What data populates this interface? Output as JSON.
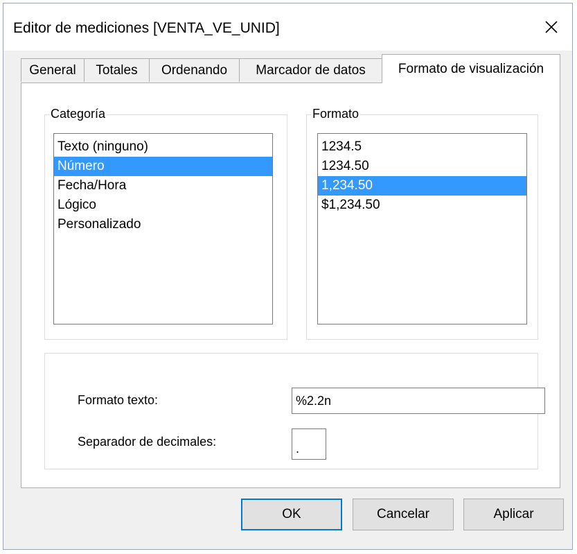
{
  "window": {
    "title": "Editor de mediciones [VENTA_VE_UNID]",
    "close_icon": "close-icon"
  },
  "tabs": [
    {
      "label": "General",
      "active": false
    },
    {
      "label": "Totales",
      "active": false
    },
    {
      "label": "Ordenando",
      "active": false
    },
    {
      "label": "Marcador de datos",
      "active": false
    },
    {
      "label": "Formato de visualización",
      "active": true
    }
  ],
  "categoria": {
    "label": "Categoría",
    "items": [
      "Texto (ninguno)",
      "Número",
      "Fecha/Hora",
      "Lógico",
      "Personalizado"
    ],
    "selected": "Número"
  },
  "formato": {
    "label": "Formato",
    "items": [
      "1234.5",
      "1234.50",
      "1,234.50",
      "$1,234.50"
    ],
    "selected": "1,234.50"
  },
  "fields": {
    "formato_texto_label": "Formato texto:",
    "formato_texto_value": "%2.2n",
    "separador_label": "Separador de decimales:",
    "separador_value": "."
  },
  "buttons": {
    "ok": "OK",
    "cancel": "Cancelar",
    "apply": "Aplicar"
  },
  "colors": {
    "selection": "#3399ff",
    "default_button_border": "#0078d7",
    "dialog_background": "#f0f0f0"
  }
}
